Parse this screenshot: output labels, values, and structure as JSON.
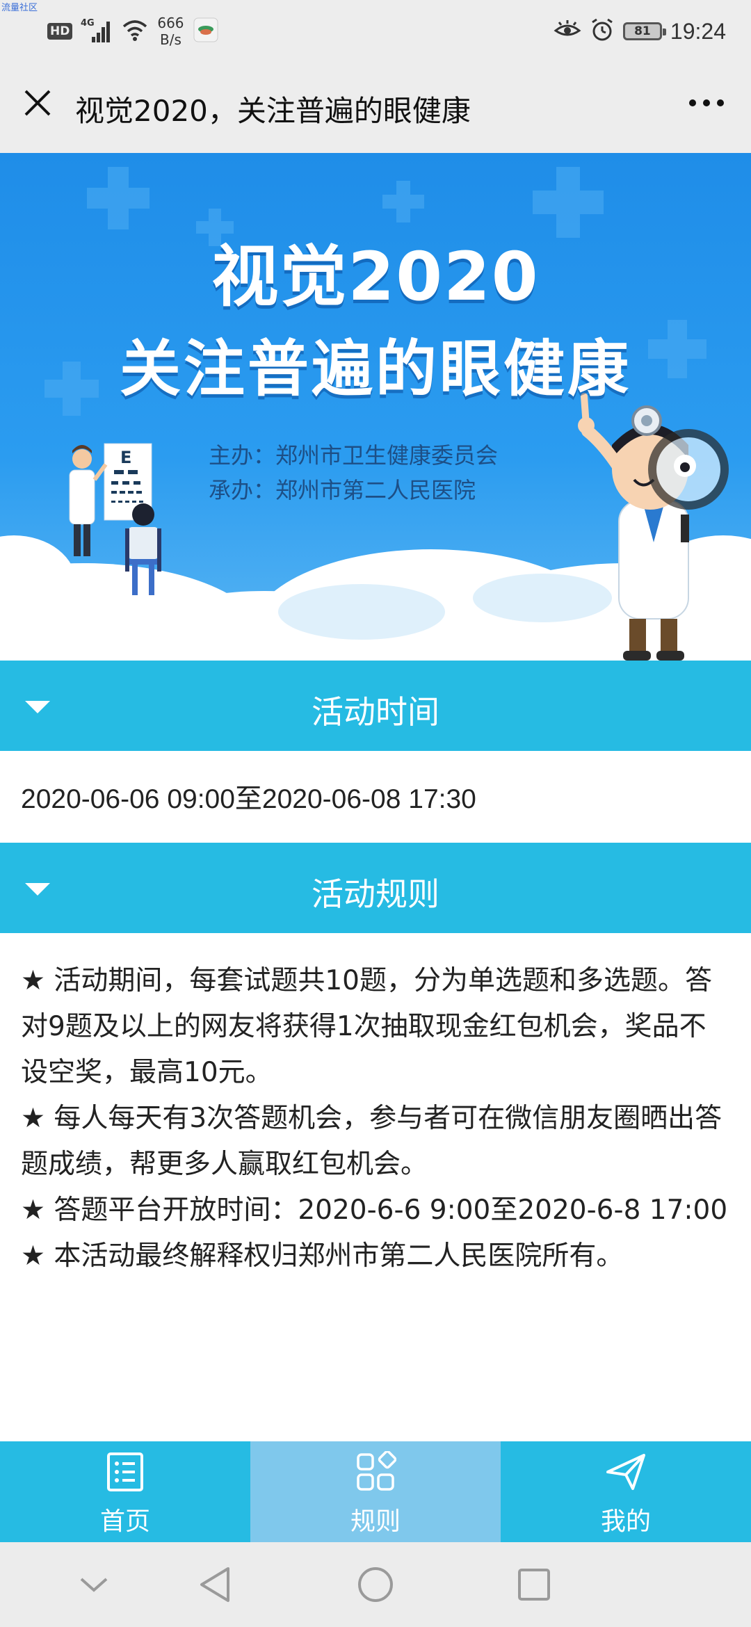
{
  "status_bar": {
    "watermark": "流量社区",
    "hd": "HD",
    "network": "4G",
    "speed_value": "666",
    "speed_unit": "B/s",
    "battery": "81",
    "time": "19:24"
  },
  "title_bar": {
    "title": "视觉2020，关注普遍的眼健康"
  },
  "banner": {
    "title_line1": "视觉2020",
    "title_line2": "关注普遍的眼健康",
    "organizer": "主办：郑州市卫生健康委员会",
    "co_organizer": "承办：郑州市第二人民医院",
    "eye_chart_top": "E"
  },
  "sections": {
    "time_header": "活动时间",
    "time_value": "2020-06-06 09:00至2020-06-08 17:30",
    "rules_header": "活动规则",
    "rules": [
      "★ 活动期间，每套试题共10题，分为单选题和多选题。答对9题及以上的网友将获得1次抽取现金红包机会，奖品不设空奖，最高10元。",
      "★ 每人每天有3次答题机会，参与者可在微信朋友圈晒出答题成绩，帮更多人赢取红包机会。",
      "★ 答题平台开放时间：2020-6-6 9:00至2020-6-8 17:00",
      "★ 本活动最终解释权归郑州市第二人民医院所有。"
    ]
  },
  "tabbar": {
    "tabs": [
      {
        "label": "首页",
        "icon": "list-icon"
      },
      {
        "label": "规则",
        "icon": "grid-icon"
      },
      {
        "label": "我的",
        "icon": "send-icon"
      }
    ],
    "active_index": 1
  },
  "colors": {
    "accent": "#26bbe3",
    "active_tab": "#7fc8ec",
    "banner_blue": "#1f8de8"
  }
}
